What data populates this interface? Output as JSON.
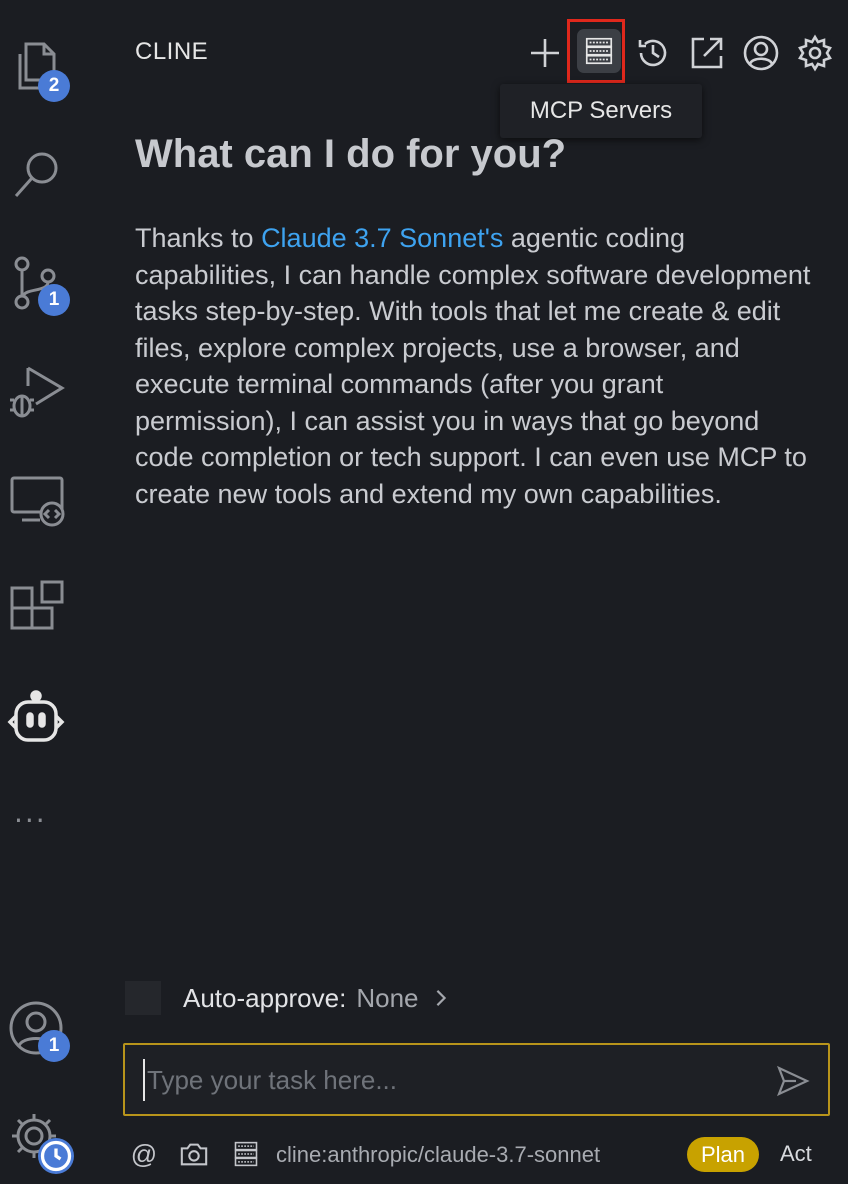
{
  "activity_bar": {
    "explorer_badge": "2",
    "source_control_badge": "1",
    "accounts_badge": "1",
    "more_label": "···"
  },
  "header": {
    "title": "CLINE",
    "tooltip": "MCP Servers",
    "highlight_color": "#e0281c"
  },
  "main": {
    "heading": "What can I do for you?",
    "intro_prefix": "Thanks to ",
    "intro_link": "Claude 3.7 Sonnet's",
    "intro_suffix": " agentic coding capabilities, I can handle complex software development tasks step-by-step. With tools that let me create & edit files, explore complex projects, use a browser, and execute terminal commands (after you grant permission), I can assist you in ways that go beyond code completion or tech support. I can even use MCP to create new tools and extend my own capabilities."
  },
  "auto_approve": {
    "label": "Auto-approve:",
    "value": "None"
  },
  "task_input": {
    "placeholder": "Type your task here..."
  },
  "bottom_bar": {
    "at_symbol": "@",
    "model": "cline:anthropic/claude-3.7-sonnet",
    "plan_label": "Plan",
    "act_label": "Act"
  },
  "colors": {
    "accent_link": "#3ea3f0",
    "plan_pill": "#c8a200",
    "badge": "#4a7bd6",
    "input_border": "#b8941b"
  }
}
